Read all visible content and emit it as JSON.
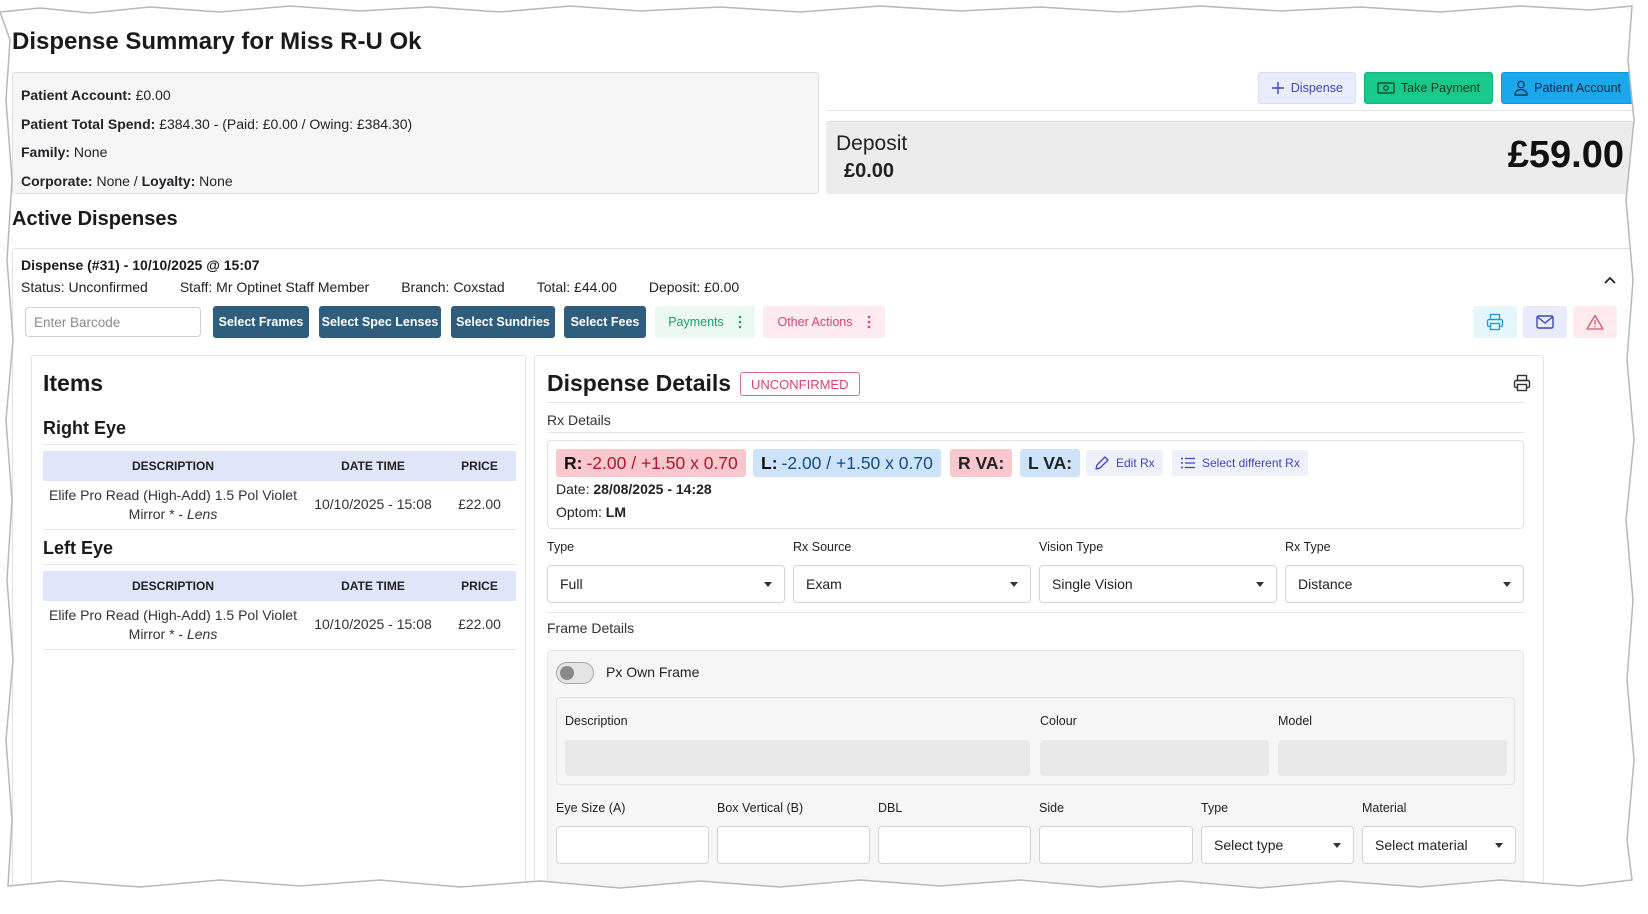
{
  "page": {
    "title": "Dispense Summary for Miss R-U Ok"
  },
  "account": {
    "patient_account_label": "Patient Account:",
    "patient_account_value": "£0.00",
    "total_spend_label": "Patient Total Spend:",
    "total_spend_value": "£384.30 - (Paid: £0.00 / Owing: £384.30)",
    "family_label": "Family:",
    "family_value": "None",
    "corporate_label": "Corporate:",
    "corporate_value": "None /",
    "loyalty_label": "Loyalty:",
    "loyalty_value": "None"
  },
  "top_actions": {
    "dispense": "Dispense",
    "take_payment": "Take Payment",
    "patient_account": "Patient Account"
  },
  "deposit": {
    "label": "Deposit",
    "value": "£0.00",
    "total": "£59.00"
  },
  "active": {
    "title": "Active Dispenses",
    "dispense_heading": "Dispense (#31) - 10/10/2025 @ 15:07",
    "status": "Status: Unconfirmed",
    "staff": "Staff: Mr Optinet Staff Member",
    "branch": "Branch: Coxstad",
    "total": "Total: £44.00",
    "deposit": "Deposit: £0.00"
  },
  "toolbar": {
    "barcode_placeholder": "Enter Barcode",
    "select_frames": "Select Frames",
    "select_spec_lenses": "Select Spec Lenses",
    "select_sundries": "Select Sundries",
    "select_fees": "Select Fees",
    "payments": "Payments",
    "other_actions": "Other Actions"
  },
  "items": {
    "title": "Items",
    "columns": [
      "DESCRIPTION",
      "DATE TIME",
      "PRICE"
    ],
    "right_eye": {
      "title": "Right Eye",
      "rows": [
        {
          "description_line1": "Elife Pro Read (High-Add) 1.5 Pol Violet",
          "description_line2": "Mirror * - ",
          "description_type": "Lens",
          "datetime": "10/10/2025 - 15:08",
          "price": "£22.00"
        }
      ]
    },
    "left_eye": {
      "title": "Left Eye",
      "rows": [
        {
          "description_line1": "Elife Pro Read (High-Add) 1.5 Pol Violet",
          "description_line2": "Mirror * - ",
          "description_type": "Lens",
          "datetime": "10/10/2025 - 15:08",
          "price": "£22.00"
        }
      ]
    }
  },
  "details": {
    "title": "Dispense Details",
    "status_badge": "UNCONFIRMED",
    "rx_details_label": "Rx Details",
    "rx": {
      "right_label": "R:",
      "right_value": "-2.00 / +1.50 x 0.70",
      "left_label": "L:",
      "left_value": "-2.00 / +1.50 x 0.70",
      "rva": "R VA:",
      "lva": "L VA:",
      "edit_rx": "Edit Rx",
      "select_different_rx": "Select different Rx",
      "date_label": "Date:",
      "date_value": "28/08/2025 - 14:28",
      "optom_label": "Optom:",
      "optom_value": "LM"
    },
    "selects": {
      "type_label": "Type",
      "type_value": "Full",
      "rx_source_label": "Rx Source",
      "rx_source_value": "Exam",
      "vision_type_label": "Vision Type",
      "vision_type_value": "Single Vision",
      "rx_type_label": "Rx Type",
      "rx_type_value": "Distance"
    },
    "frame": {
      "label": "Frame Details",
      "px_own_frame": "Px Own Frame",
      "description_label": "Description",
      "colour_label": "Colour",
      "model_label": "Model",
      "eye_size_label": "Eye Size (A)",
      "box_vertical_label": "Box Vertical (B)",
      "dbl_label": "DBL",
      "side_label": "Side",
      "type_label": "Type",
      "type_placeholder": "Select type",
      "material_label": "Material",
      "material_placeholder": "Select material"
    }
  },
  "colors": {
    "primary_dark": "#2f5d7e",
    "success": "#18c98b",
    "info": "#1aa7ec",
    "danger": "#d9436d",
    "right_eye_bg": "#f8c8cc",
    "left_eye_bg": "#cde3fa"
  }
}
